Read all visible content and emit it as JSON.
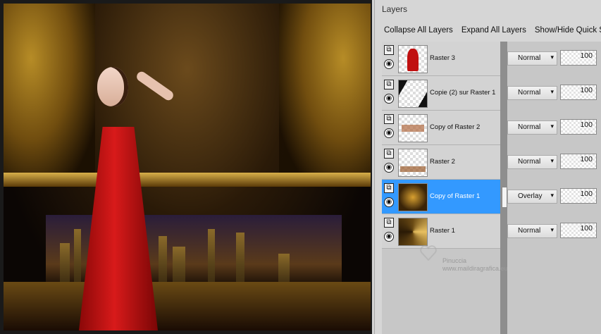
{
  "panel": {
    "title": "Layers",
    "toolbar": {
      "collapse": "Collapse All Layers",
      "expand": "Expand All Layers",
      "showhide": "Show/Hide Quick Se"
    }
  },
  "layers": [
    {
      "name": "Raster 3",
      "blend": "Normal",
      "opacity": "100",
      "selected": false
    },
    {
      "name": "Copie (2) sur Raster 1",
      "blend": "Normal",
      "opacity": "100",
      "selected": false
    },
    {
      "name": "Copy of Raster 2",
      "blend": "Normal",
      "opacity": "100",
      "selected": false
    },
    {
      "name": "Raster 2",
      "blend": "Normal",
      "opacity": "100",
      "selected": false
    },
    {
      "name": "Copy of Raster 1",
      "blend": "Overlay",
      "opacity": "100",
      "selected": true
    },
    {
      "name": "Raster 1",
      "blend": "Normal",
      "opacity": "100",
      "selected": false
    }
  ],
  "watermark": {
    "line1": "Pinuccia",
    "line2": "www.maildiragrafica.eu"
  },
  "colors": {
    "selected": "#3399ff",
    "panel_bg": "#d6d6d6"
  }
}
